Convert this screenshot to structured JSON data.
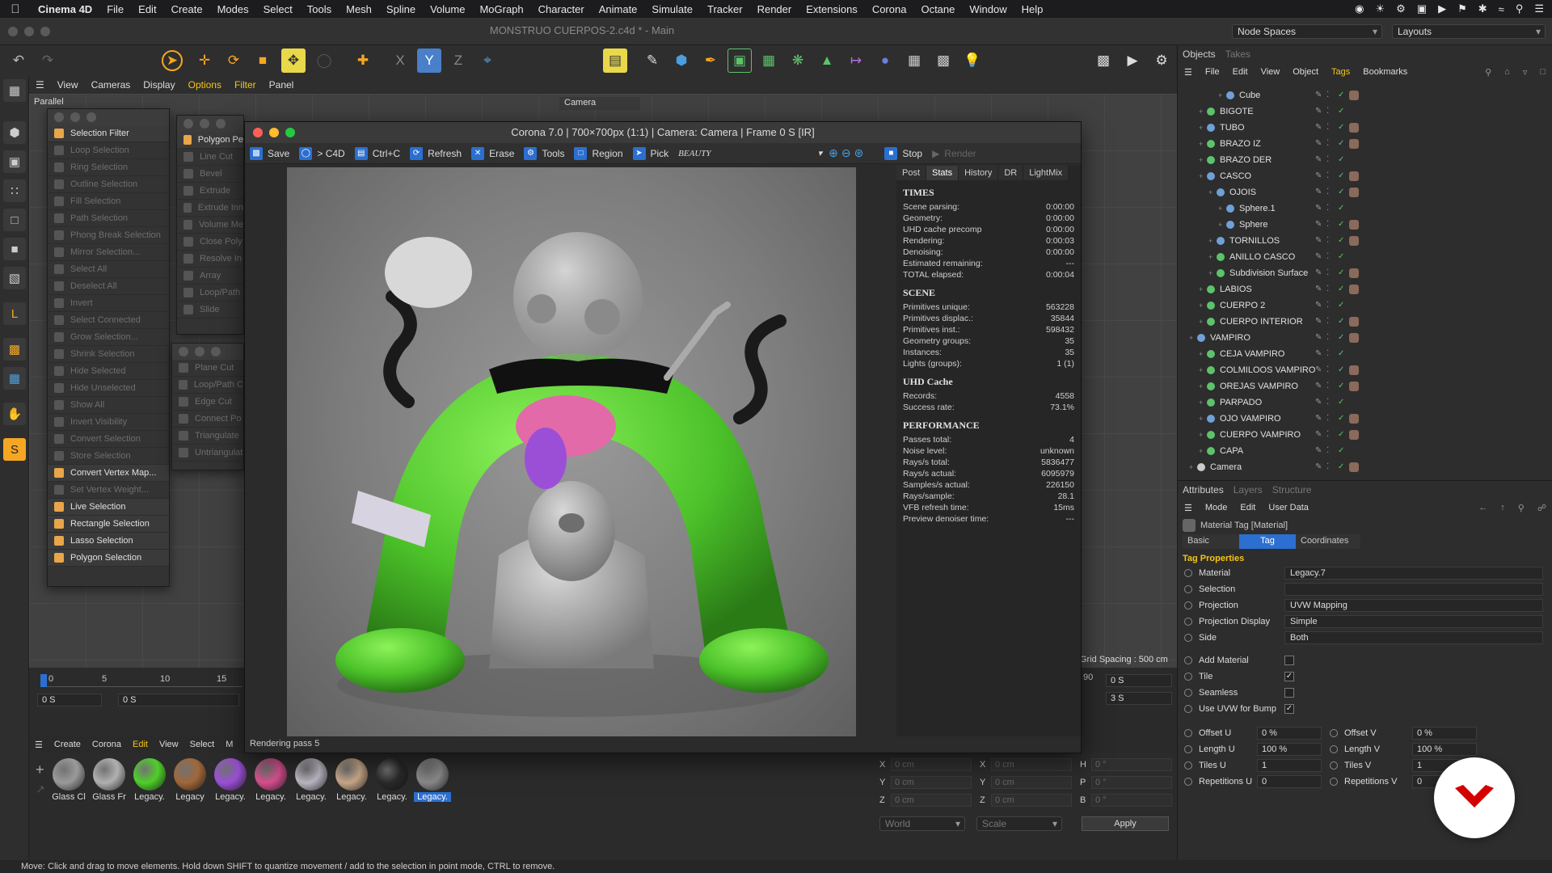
{
  "menubar": {
    "app": "Cinema 4D",
    "items": [
      "File",
      "Edit",
      "Create",
      "Modes",
      "Select",
      "Tools",
      "Mesh",
      "Spline",
      "Volume",
      "MoGraph",
      "Character",
      "Animate",
      "Simulate",
      "Tracker",
      "Render",
      "Extensions",
      "Corona",
      "Octane",
      "Window",
      "Help"
    ]
  },
  "window": {
    "title": "MONSTRUO CUERPOS-2.c4d * - Main",
    "node_spaces": "Node Spaces",
    "layouts": "Layouts"
  },
  "viewport": {
    "menu": [
      "View",
      "Cameras",
      "Display",
      "Options",
      "Filter",
      "Panel"
    ],
    "menu_selected": "Options",
    "projection_label": "Parallel",
    "camera_label": "Camera",
    "grid_spacing": "Grid Spacing : 500 cm"
  },
  "selection_filter": {
    "title": "Selection Filter",
    "items": [
      {
        "label": "Loop Selection",
        "active": false
      },
      {
        "label": "Ring Selection",
        "active": false
      },
      {
        "label": "Outline Selection",
        "active": false
      },
      {
        "label": "Fill Selection",
        "active": false
      },
      {
        "label": "Path Selection",
        "active": false
      },
      {
        "label": "Phong Break Selection",
        "active": false
      },
      {
        "label": "Mirror Selection...",
        "active": false
      },
      {
        "label": "Select All",
        "active": false
      },
      {
        "label": "Deselect All",
        "active": false
      },
      {
        "label": "Invert",
        "active": false
      },
      {
        "label": "Select Connected",
        "active": false
      },
      {
        "label": "Grow Selection...",
        "active": false
      },
      {
        "label": "Shrink Selection",
        "active": false
      },
      {
        "label": "Hide Selected",
        "active": false
      },
      {
        "label": "Hide Unselected",
        "active": false
      },
      {
        "label": "Show All",
        "active": false
      },
      {
        "label": "Invert Visibility",
        "active": false
      },
      {
        "label": "Convert Selection",
        "active": false
      },
      {
        "label": "Store Selection",
        "active": false
      },
      {
        "label": "Convert Vertex Map...",
        "active": true
      },
      {
        "label": "Set Vertex Weight...",
        "active": false
      },
      {
        "label": "Live Selection",
        "active": true
      },
      {
        "label": "Rectangle Selection",
        "active": true
      },
      {
        "label": "Lasso Selection",
        "active": true
      },
      {
        "label": "Polygon Selection",
        "active": true
      }
    ]
  },
  "polygon_palette": {
    "title": "Polygon Pe",
    "items": [
      "Line Cut",
      "Bevel",
      "Extrude",
      "Extrude Inn",
      "Volume Me",
      "Close Poly",
      "Resolve In",
      "Array",
      "Loop/Path",
      "Slide"
    ]
  },
  "knife_palette": {
    "items": [
      "Plane Cut",
      "Loop/Path C",
      "Edge Cut",
      "Connect Po",
      "Triangulate",
      "Untriangulat"
    ]
  },
  "vfb": {
    "title": "Corona 7.0 | 700×700px (1:1) | Camera: Camera | Frame 0 S [IR]",
    "toolbar": {
      "save": "Save",
      "c4d": "> C4D",
      "copy": "Ctrl+C",
      "refresh": "Refresh",
      "erase": "Erase",
      "tools": "Tools",
      "region": "Region",
      "pick": "Pick",
      "pass": "BEAUTY",
      "stop": "Stop",
      "render": "Render"
    },
    "tabs": [
      "Post",
      "Stats",
      "History",
      "DR",
      "LightMix"
    ],
    "tab_selected": "Stats",
    "stats": {
      "times_header": "TIMES",
      "times": [
        [
          "Scene parsing:",
          "0:00:00"
        ],
        [
          "Geometry:",
          "0:00:00"
        ],
        [
          "UHD cache precomp",
          "0:00:00"
        ],
        [
          "Rendering:",
          "0:00:03"
        ],
        [
          "Denoising:",
          "0:00:00"
        ],
        [
          "Estimated remaining:",
          "---"
        ],
        [
          "TOTAL elapsed:",
          "0:00:04"
        ]
      ],
      "scene_header": "SCENE",
      "scene": [
        [
          "Primitives unique:",
          "563228"
        ],
        [
          "Primitives displac.:",
          "35844"
        ],
        [
          "Primitives inst.:",
          "598432"
        ],
        [
          "Geometry groups:",
          "35"
        ],
        [
          "Instances:",
          "35"
        ],
        [
          "Lights (groups):",
          "1 (1)"
        ]
      ],
      "uhd_header": "UHD Cache",
      "uhd": [
        [
          "Records:",
          "4558"
        ],
        [
          "Success rate:",
          "73.1%"
        ]
      ],
      "perf_header": "PERFORMANCE",
      "perf": [
        [
          "Passes total:",
          "4"
        ],
        [
          "Noise level:",
          "unknown"
        ],
        [
          "Rays/s total:",
          "5836477"
        ],
        [
          "Rays/s actual:",
          "6095979"
        ],
        [
          "Samples/s actual:",
          "226150"
        ],
        [
          "Rays/sample:",
          "28.1"
        ],
        [
          "VFB refresh time:",
          "15ms"
        ],
        [
          "Preview denoiser time:",
          "---"
        ]
      ]
    },
    "status": "Rendering pass 5"
  },
  "objects_panel": {
    "tabs": [
      "Objects",
      "Takes"
    ],
    "menu": [
      "File",
      "Edit",
      "View",
      "Object",
      "Tags",
      "Bookmarks"
    ],
    "menu_selected": "Tags",
    "rows": [
      {
        "name": "Cube",
        "indent": 3,
        "color": "#6fa0d8"
      },
      {
        "name": "BIGOTE",
        "indent": 1,
        "color": "#5cc36a"
      },
      {
        "name": "TUBO",
        "indent": 1,
        "color": "#6fa0d8"
      },
      {
        "name": "BRAZO IZ",
        "indent": 1,
        "color": "#5cc36a"
      },
      {
        "name": "BRAZO DER",
        "indent": 1,
        "color": "#5cc36a"
      },
      {
        "name": "CASCO",
        "indent": 1,
        "color": "#6fa0d8"
      },
      {
        "name": "OJOIS",
        "indent": 2,
        "color": "#6fa0d8"
      },
      {
        "name": "Sphere.1",
        "indent": 3,
        "color": "#6fa0d8"
      },
      {
        "name": "Sphere",
        "indent": 3,
        "color": "#6fa0d8"
      },
      {
        "name": "TORNILLOS",
        "indent": 2,
        "color": "#6fa0d8"
      },
      {
        "name": "ANILLO CASCO",
        "indent": 2,
        "color": "#5cc36a"
      },
      {
        "name": "Subdivision Surface",
        "indent": 2,
        "color": "#5cc36a"
      },
      {
        "name": "LABIOS",
        "indent": 1,
        "color": "#5cc36a"
      },
      {
        "name": "CUERPO 2",
        "indent": 1,
        "color": "#5cc36a"
      },
      {
        "name": "CUERPO INTERIOR",
        "indent": 1,
        "color": "#5cc36a"
      },
      {
        "name": "VAMPIRO",
        "indent": 0,
        "color": "#6fa0d8"
      },
      {
        "name": "CEJA VAMPIRO",
        "indent": 1,
        "color": "#5cc36a"
      },
      {
        "name": "COLMILOOS VAMPIRO",
        "indent": 1,
        "color": "#5cc36a"
      },
      {
        "name": "OREJAS VAMPIRO",
        "indent": 1,
        "color": "#5cc36a"
      },
      {
        "name": "PARPADO",
        "indent": 1,
        "color": "#5cc36a"
      },
      {
        "name": "OJO VAMPIRO",
        "indent": 1,
        "color": "#6fa0d8"
      },
      {
        "name": "CUERPO VAMPIRO",
        "indent": 1,
        "color": "#5cc36a"
      },
      {
        "name": "CAPA",
        "indent": 1,
        "color": "#5cc36a"
      },
      {
        "name": "Camera",
        "indent": 0,
        "color": "#cccccc"
      }
    ]
  },
  "attributes": {
    "tabs": [
      "Attributes",
      "Layers",
      "Structure"
    ],
    "menu": [
      "Mode",
      "Edit",
      "User Data"
    ],
    "object_title": "Material Tag [Material]",
    "subtabs": [
      "Basic",
      "Tag",
      "Coordinates"
    ],
    "subtab_selected": "Tag",
    "section": "Tag Properties",
    "fields": [
      {
        "label": "Material",
        "value": "Legacy.7"
      },
      {
        "label": "Selection",
        "value": ""
      },
      {
        "label": "Projection",
        "value": "UVW Mapping"
      },
      {
        "label": "Projection Display",
        "value": "Simple"
      },
      {
        "label": "Side",
        "value": "Both"
      }
    ],
    "checks": [
      {
        "label": "Add Material",
        "checked": false
      },
      {
        "label": "Tile",
        "checked": true
      },
      {
        "label": "Seamless",
        "checked": false
      },
      {
        "label": "Use UVW for Bump",
        "checked": true
      }
    ],
    "offset_u": {
      "label": "Offset U",
      "value": "0 %"
    },
    "offset_v": {
      "label": "Offset V",
      "value": "0 %"
    },
    "length_u": {
      "label": "Length U",
      "value": "100 %"
    },
    "length_v": {
      "label": "Length V",
      "value": "100 %"
    },
    "tiles_u": {
      "label": "Tiles U",
      "value": "1"
    },
    "tiles_v": {
      "label": "Tiles V",
      "value": "1"
    },
    "rep_u": {
      "label": "Repetitions U",
      "value": "0"
    },
    "rep_v": {
      "label": "Repetitions V",
      "value": "0"
    }
  },
  "timeline": {
    "ticks": [
      "0",
      "5",
      "10",
      "15"
    ],
    "start": "0 S",
    "current": "0 S",
    "end_frame": "90",
    "end_time": "0 S",
    "max_time": "3 S"
  },
  "materials": {
    "menu": [
      "Create",
      "Corona",
      "Edit",
      "View",
      "Select",
      "M"
    ],
    "menu_selected": "Edit",
    "items": [
      {
        "label": "Glass Cl",
        "color": "#9a9a9a"
      },
      {
        "label": "Glass Fr",
        "color": "#b0b0b0"
      },
      {
        "label": "Legacy.",
        "color": "#4fcf2a"
      },
      {
        "label": "Legacy",
        "color": "#a0683a"
      },
      {
        "label": "Legacy.",
        "color": "#9b4fd6"
      },
      {
        "label": "Legacy.",
        "color": "#d8508f"
      },
      {
        "label": "Legacy.",
        "color": "#bdb8c4"
      },
      {
        "label": "Legacy.",
        "color": "#c9a98a"
      },
      {
        "label": "Legacy.",
        "color": "#2a2a2a"
      },
      {
        "label": "Legacy.",
        "color": "#8a8a8a"
      }
    ]
  },
  "coords": {
    "rows": [
      [
        "X",
        "0 cm",
        "X",
        "0 cm",
        "H",
        "0 °"
      ],
      [
        "Y",
        "0 cm",
        "Y",
        "0 cm",
        "P",
        "0 °"
      ],
      [
        "Z",
        "0 cm",
        "Z",
        "0 cm",
        "B",
        "0 °"
      ]
    ],
    "world": "World",
    "scale": "Scale",
    "apply": "Apply"
  },
  "statusbar": "Move: Click and drag to move elements. Hold down SHIFT to quantize movement / add to the selection in point mode, CTRL to remove.",
  "colors": {
    "accent": "#f5c518",
    "selection_blue": "#2b6fd1",
    "brand_red": "#d40000"
  }
}
